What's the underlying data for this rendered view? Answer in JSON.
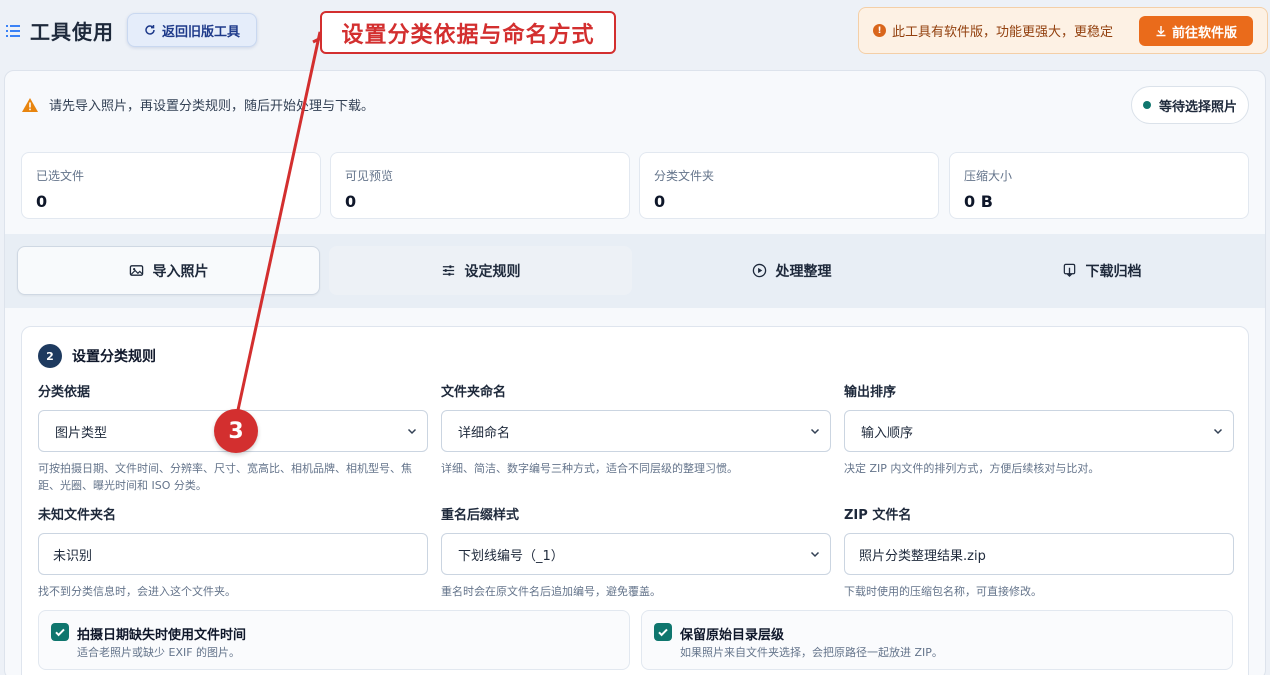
{
  "header": {
    "title": "工具使用",
    "old_button": "返回旧版工具",
    "notice": "此工具有软件版，功能更强大，更稳定",
    "notice_button": "前往软件版"
  },
  "alert": {
    "text": "请先导入照片，再设置分类规则，随后开始处理与下载。",
    "status": "等待选择照片"
  },
  "stats": [
    {
      "label": "已选文件",
      "value": "0"
    },
    {
      "label": "可见预览",
      "value": "0"
    },
    {
      "label": "分类文件夹",
      "value": "0"
    },
    {
      "label": "压缩大小",
      "value": "0 B"
    }
  ],
  "tabs": [
    {
      "label": "导入照片",
      "icon": "image-icon"
    },
    {
      "label": "设定规则",
      "icon": "sliders-icon"
    },
    {
      "label": "处理整理",
      "icon": "play-icon"
    },
    {
      "label": "下载归档",
      "icon": "download-icon"
    }
  ],
  "step": {
    "number": "2",
    "title": "设置分类规则"
  },
  "fields": {
    "classify": {
      "label": "分类依据",
      "value": "图片类型",
      "hint": "可按拍摄日期、文件时间、分辨率、尺寸、宽高比、相机品牌、相机型号、焦距、光圈、曝光时间和 ISO 分类。"
    },
    "folder_naming": {
      "label": "文件夹命名",
      "value": "详细命名",
      "hint": "详细、简洁、数字编号三种方式，适合不同层级的整理习惯。"
    },
    "sort": {
      "label": "输出排序",
      "value": "输入顺序",
      "hint": "决定 ZIP 内文件的排列方式，方便后续核对与比对。"
    },
    "unknown_folder": {
      "label": "未知文件夹名",
      "value": "未识别",
      "hint": "找不到分类信息时，会进入这个文件夹。"
    },
    "rename_suffix": {
      "label": "重名后缀样式",
      "value": "下划线编号（_1）",
      "hint": "重名时会在原文件名后追加编号，避免覆盖。"
    },
    "zip_name": {
      "label": "ZIP 文件名",
      "value": "照片分类整理结果.zip",
      "hint": "下载时使用的压缩包名称，可直接修改。"
    }
  },
  "checks": [
    {
      "title": "拍摄日期缺失时使用文件时间",
      "desc": "适合老照片或缺少 EXIF 的图片。",
      "checked": true
    },
    {
      "title": "保留原始目录层级",
      "desc": "如果照片来自文件夹选择，会把原路径一起放进 ZIP。",
      "checked": true
    }
  ],
  "annotation": {
    "callout": "设置分类依据与命名方式",
    "number": "3",
    "color": "#d32f2f"
  },
  "colors": {
    "accent": "#0f766e",
    "warning": "#ea6b1b",
    "annotation": "#d32f2f"
  }
}
